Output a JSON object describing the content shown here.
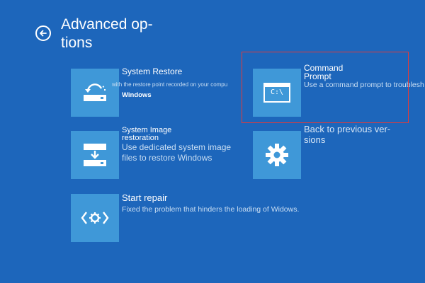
{
  "page": {
    "title_line1": "Advanced op-",
    "title_line2": "tions"
  },
  "icons": {
    "back": "back-arrow-icon",
    "restore": "system-restore-icon",
    "image": "system-image-icon",
    "repair": "repair-icon",
    "cmd": "command-prompt-icon",
    "gear": "gear-icon"
  },
  "colors": {
    "background": "#1d66bb",
    "tile": "#3f98d8",
    "highlight": "#e23b3b",
    "description": "#c9def3"
  },
  "tiles": {
    "restore": {
      "title": "System Restore",
      "desc_line1": "with the restore point recorded on your compu",
      "desc_line2": "Windows"
    },
    "image": {
      "title_line1": "System Image",
      "title_line2": "restoration",
      "desc_line1": "Use dedicated system image",
      "desc_line2": "files to restore Windows"
    },
    "repair": {
      "title": "Start repair",
      "desc": "Fixed the problem that hinders the loading of Widows."
    },
    "cmd": {
      "title_line1": "Command",
      "title_line2": "Prompt",
      "desc": "Use a command prompt to troublesh",
      "icon_text": "C:\\"
    },
    "back": {
      "title_line1": "Back to previous ver-",
      "title_line2": "sions"
    }
  }
}
